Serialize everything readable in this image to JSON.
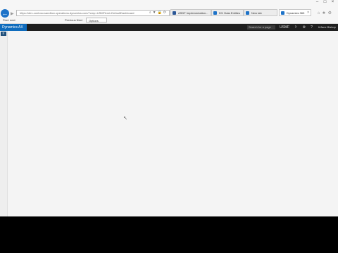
{
  "browser": {
    "url": "https://dev-contoso.sandbox.operations.dynamics.com/?cmp=USMF&mi=DefaultDashboard",
    "tabs": [
      {
        "label": "ASDF Implementation...",
        "favicon_color": "#2b5797"
      },
      {
        "label": "D3: Data Entities",
        "favicon_color": "#1e73c8"
      },
      {
        "label": "New tab",
        "favicon_color": "#1e73c8"
      },
      {
        "label": "Dynamics 365",
        "favicon_color": "#1e73c8"
      }
    ],
    "window_controls": [
      "–",
      "□",
      "×"
    ],
    "menu_file": "Find: next",
    "translate_label": "Previous  Next",
    "options_label": "Options"
  },
  "appbar": {
    "brand": "Dynamics AX",
    "search_placeholder": "Search for a page",
    "company": "USMF",
    "user": "Jane Bishop"
  },
  "icons": {
    "back": "back-arrow-icon",
    "forward": "forward-arrow-icon",
    "notifications": "bell-icon",
    "settings": "gear-icon",
    "help": "question-icon",
    "smile": "smile-icon",
    "menu": "hamburger-icon"
  }
}
